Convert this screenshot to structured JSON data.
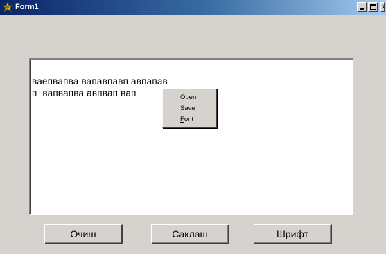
{
  "window": {
    "title": "Form1",
    "icon": "app-star-icon"
  },
  "memo": {
    "lines": [
      "ваепвапва вапавпавп авпапав",
      "п  вапвапва авпвап вап"
    ]
  },
  "context_menu": {
    "items": [
      {
        "accel": "O",
        "rest": "pen"
      },
      {
        "accel": "S",
        "rest": "ave"
      },
      {
        "accel": "F",
        "rest": "ont"
      }
    ]
  },
  "buttons": {
    "clear_label": "Очиш",
    "save_label": "Саклаш",
    "font_label": "Шрифт"
  }
}
